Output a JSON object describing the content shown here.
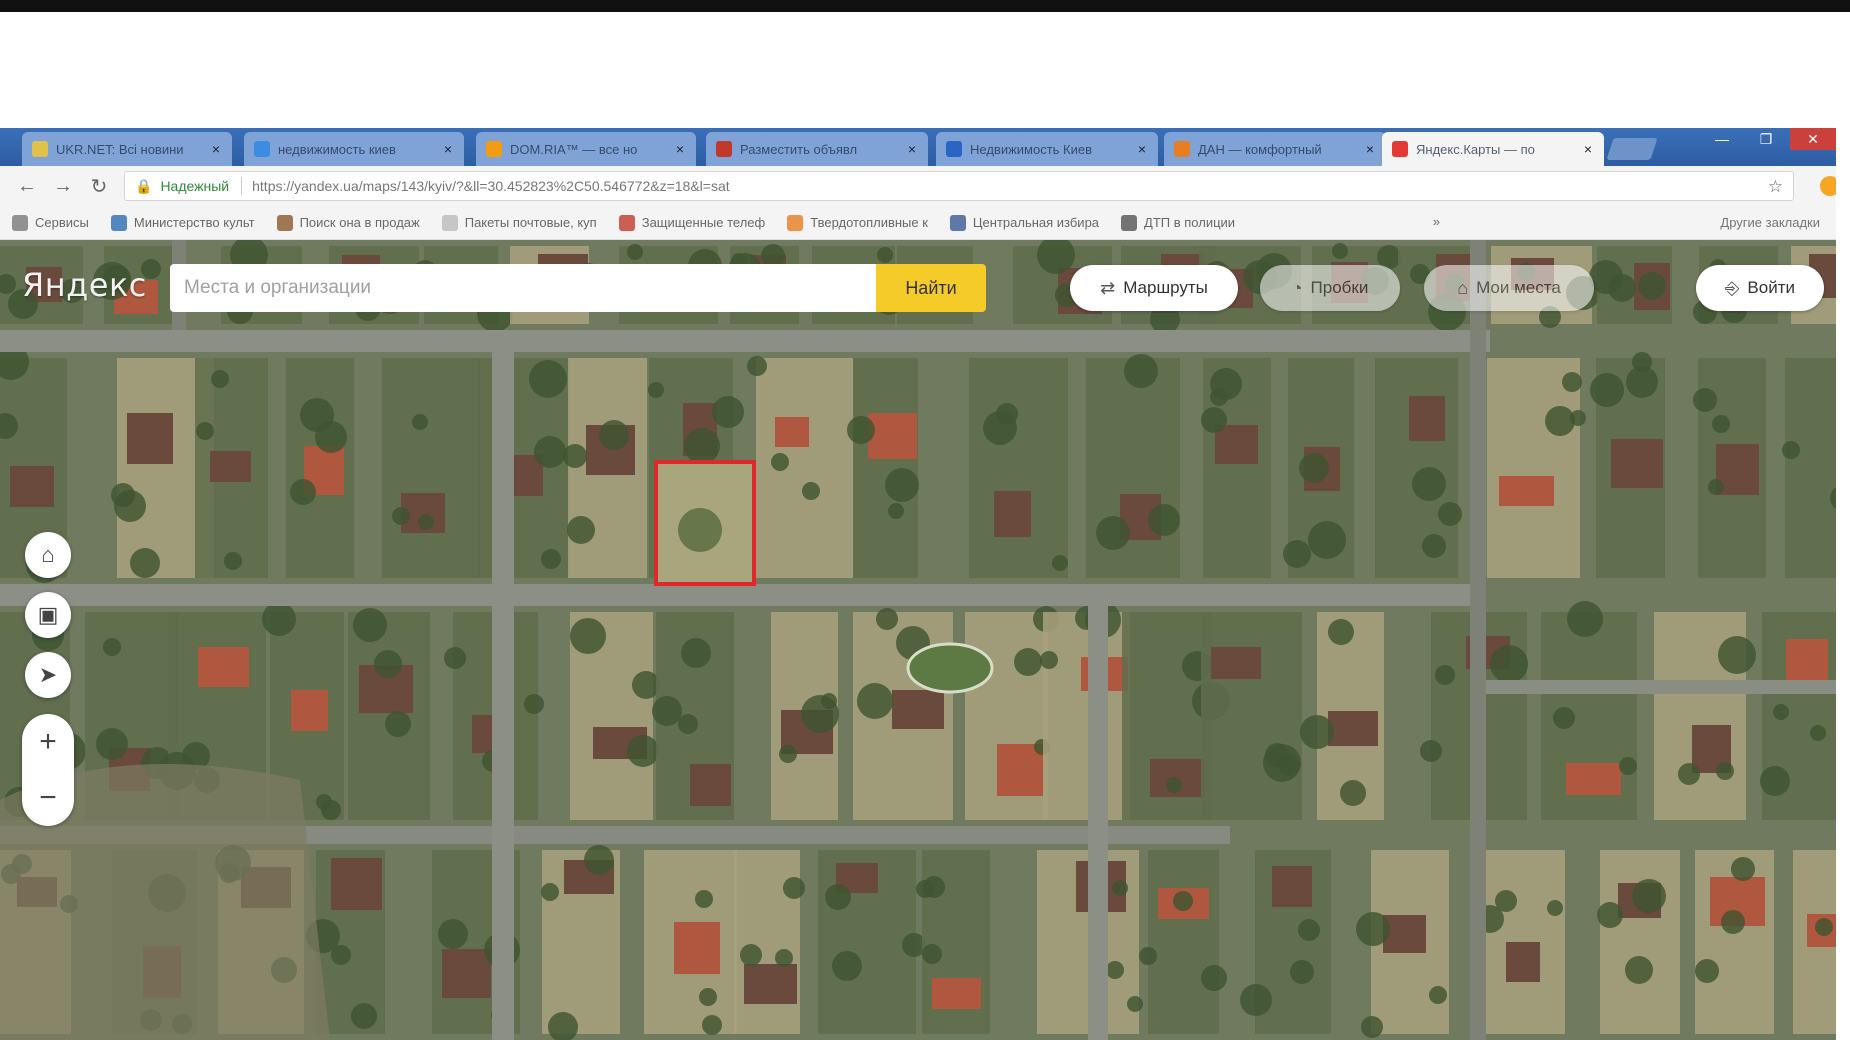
{
  "browser": {
    "tabs": [
      {
        "label": "UKR.NET: Всі новини",
        "favicon_color": "#e0c24a",
        "active": false
      },
      {
        "label": "недвижимость киев",
        "favicon_color": "#3b8de0",
        "active": false
      },
      {
        "label": "DOM.RIA™ — все но",
        "favicon_color": "#f39c12",
        "active": false
      },
      {
        "label": "Разместить объявл",
        "favicon_color": "#c0392b",
        "active": false
      },
      {
        "label": "Недвижимость Киев",
        "favicon_color": "#2a65c5",
        "active": false
      },
      {
        "label": "ДАН — комфортный",
        "favicon_color": "#e67e22",
        "active": false
      },
      {
        "label": "Яндекс.Карты — по",
        "favicon_color": "#e53935",
        "active": true
      }
    ],
    "close_glyph": "×",
    "window_buttons": {
      "minimize": "—",
      "maximize": "❐",
      "close": "✕"
    },
    "nav": {
      "back": "←",
      "forward": "→",
      "reload": "↻"
    },
    "security_label": "Надежный",
    "url": "https://yandex.ua/maps/143/kyiv/?&ll=30.452823%2C50.546772&z=18&l=sat",
    "bookmarks": [
      {
        "label": "Сервисы",
        "icon_color": "#7a7a7a"
      },
      {
        "label": "Министерство культ",
        "icon_color": "#2b6cb0"
      },
      {
        "label": "Поиск она в продаж",
        "icon_color": "#8a5a2b"
      },
      {
        "label": "Пакеты почтовые, куп",
        "icon_color": "#bbbbbb"
      },
      {
        "label": "Защищенные телеф",
        "icon_color": "#c0392b"
      },
      {
        "label": "Твердотопливные к",
        "icon_color": "#e67e22"
      },
      {
        "label": "Центральная избира",
        "icon_color": "#3b5998"
      },
      {
        "label": "ДТП в полиции",
        "icon_color": "#555555"
      }
    ],
    "bookmarks_more": "Другие закладки"
  },
  "map": {
    "logo": "Яндекс",
    "search": {
      "placeholder": "Места и организации",
      "button": "Найти"
    },
    "pills": [
      {
        "icon": "route-icon",
        "glyph": "⇄",
        "label": "Маршруты"
      },
      {
        "icon": "traffic-icon",
        "glyph": "◔",
        "label": "Пробки"
      },
      {
        "icon": "bookmark-icon",
        "glyph": "⌂",
        "label": "Мои места"
      },
      {
        "icon": "login-icon",
        "glyph": "⎆",
        "label": "Войти"
      }
    ],
    "controls": {
      "home": "⌂",
      "layers": "▣",
      "locate": "➤",
      "zoom_in": "+",
      "zoom_out": "−"
    },
    "highlight_color": "#e0282b",
    "imagery_colors": {
      "road": "#8c8f86",
      "lot": "#a9a17d",
      "tree": "#3f5431",
      "roof": "#6a4a3c"
    }
  }
}
